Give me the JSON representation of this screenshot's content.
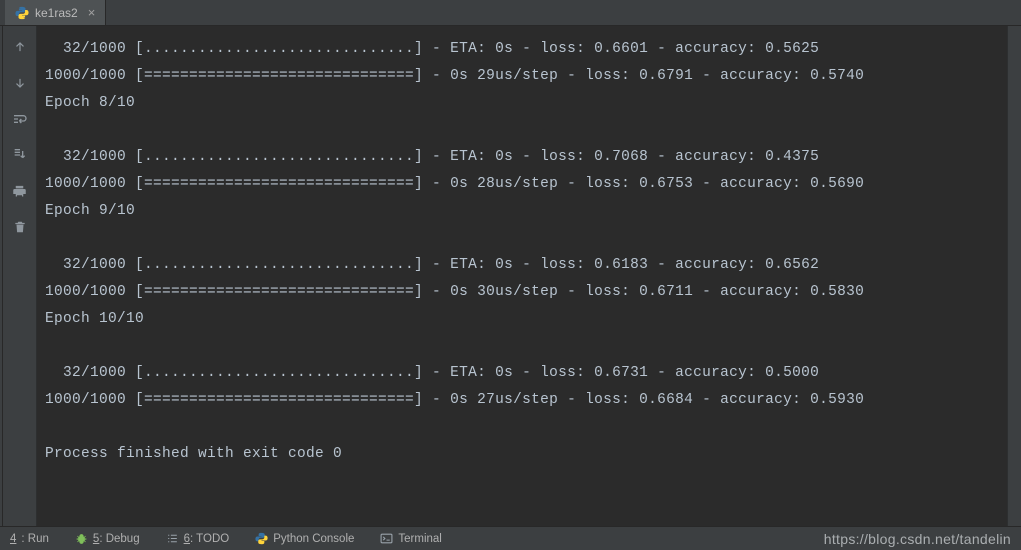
{
  "tab": {
    "title": "ke1ras2",
    "close_glyph": "×"
  },
  "toolbar": {
    "up": "↑",
    "down": "↓",
    "wrap": "⇆",
    "scroll_to_end": "⇲",
    "print": "🖶",
    "delete": "🗑"
  },
  "console_output": "  32/1000 [..............................] - ETA: 0s - loss: 0.6601 - accuracy: 0.5625\n1000/1000 [==============================] - 0s 29us/step - loss: 0.6791 - accuracy: 0.5740\nEpoch 8/10\n\n  32/1000 [..............................] - ETA: 0s - loss: 0.7068 - accuracy: 0.4375\n1000/1000 [==============================] - 0s 28us/step - loss: 0.6753 - accuracy: 0.5690\nEpoch 9/10\n\n  32/1000 [..............................] - ETA: 0s - loss: 0.6183 - accuracy: 0.6562\n1000/1000 [==============================] - 0s 30us/step - loss: 0.6711 - accuracy: 0.5830\nEpoch 10/10\n\n  32/1000 [..............................] - ETA: 0s - loss: 0.6731 - accuracy: 0.5000\n1000/1000 [==============================] - 0s 27us/step - loss: 0.6684 - accuracy: 0.5930\n\nProcess finished with exit code 0",
  "bottom": {
    "run_prefix": "4",
    "run_label": ": Run",
    "debug_prefix": "5",
    "debug_label": ": Debug",
    "todo_prefix": "6",
    "todo_label": ": TODO",
    "python_console": "Python Console",
    "terminal": "Terminal"
  },
  "watermark": "https://blog.csdn.net/tandelin"
}
